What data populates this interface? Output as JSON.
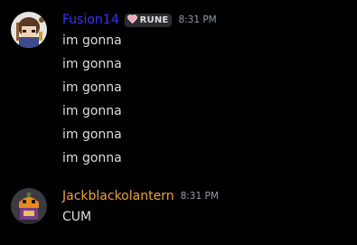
{
  "messages": [
    {
      "author": "Fusion14",
      "author_color": "#3b34f2",
      "tag": {
        "icon": "heart-icon",
        "label": "RUNE"
      },
      "timestamp": "8:31 PM",
      "lines": [
        "im gonna",
        "im gonna",
        "im gonna",
        "im gonna",
        "im gonna",
        "im gonna"
      ]
    },
    {
      "author": "Jackblackolantern",
      "author_color": "#f0a43a",
      "timestamp": "8:31 PM",
      "lines": [
        "CUM"
      ]
    }
  ],
  "colors": {
    "background": "#000000",
    "message_text": "#dbdee1",
    "timestamp": "#949ba4"
  }
}
